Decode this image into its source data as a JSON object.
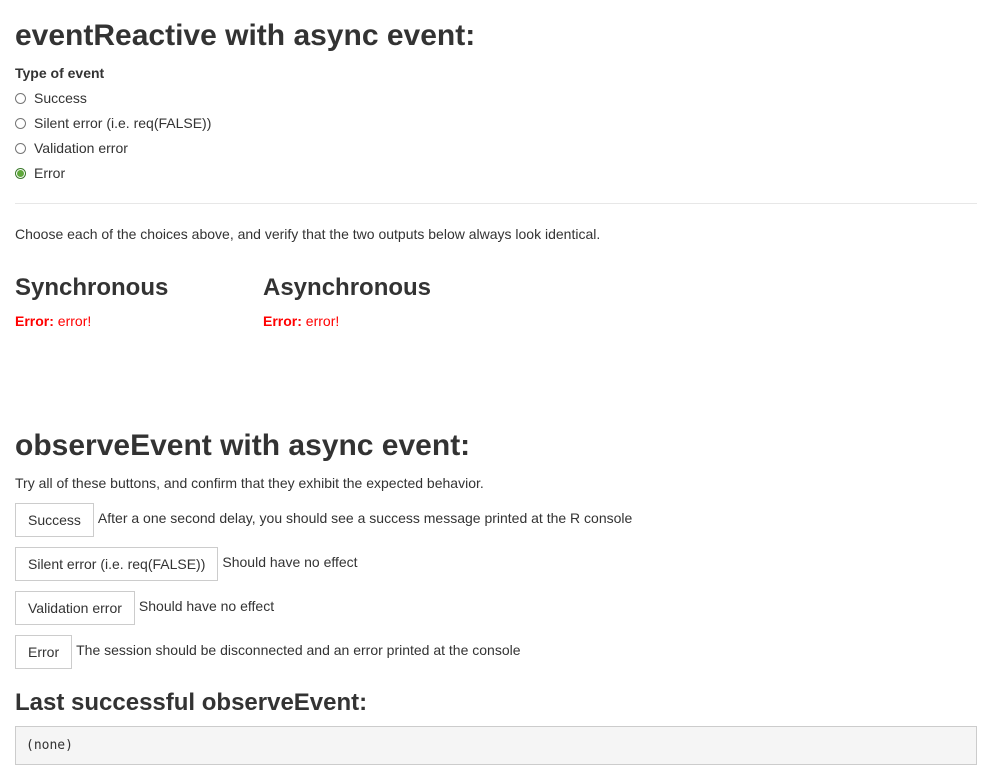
{
  "section1": {
    "title": "eventReactive with async event:",
    "control_label": "Type of event",
    "options": [
      {
        "label": "Success",
        "checked": false
      },
      {
        "label": "Silent error (i.e. req(FALSE))",
        "checked": false
      },
      {
        "label": "Validation error",
        "checked": false
      },
      {
        "label": "Error",
        "checked": true
      }
    ],
    "instructions": "Choose each of the choices above, and verify that the two outputs below always look identical.",
    "sync": {
      "title": "Synchronous",
      "error_label": "Error:",
      "error_text": " error!"
    },
    "async": {
      "title": "Asynchronous",
      "error_label": "Error:",
      "error_text": " error!"
    }
  },
  "section2": {
    "title": "observeEvent with async event:",
    "instructions": "Try all of these buttons, and confirm that they exhibit the expected behavior.",
    "buttons": [
      {
        "label": "Success",
        "description": "After a one second delay, you should see a success message printed at the R console"
      },
      {
        "label": "Silent error (i.e. req(FALSE))",
        "description": "Should have no effect"
      },
      {
        "label": "Validation error",
        "description": "Should have no effect"
      },
      {
        "label": "Error",
        "description": "The session should be disconnected and an error printed at the console"
      }
    ],
    "last_title": "Last successful observeEvent:",
    "last_output": "(none)"
  },
  "colors": {
    "text": "#333333",
    "error": "#ff0000",
    "radio_checked": "#5fa83b",
    "pre_background": "#f5f5f5"
  }
}
